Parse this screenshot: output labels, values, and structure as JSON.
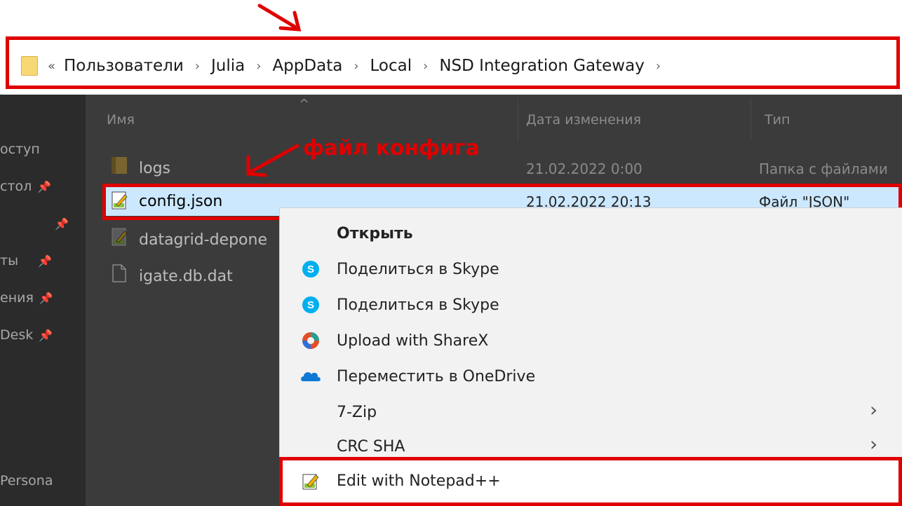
{
  "annotation": {
    "top_text": "",
    "config_label": "файл конфига"
  },
  "address_bar": {
    "overflow": "«",
    "crumbs": [
      "Пользователи",
      "Julia",
      "AppData",
      "Local",
      "NSD Integration Gateway"
    ],
    "separator": "›"
  },
  "columns": {
    "name": "Имя",
    "date": "Дата изменения",
    "type": "Тип"
  },
  "nav": {
    "items": [
      "оступ",
      "стол",
      "",
      "ты",
      "ения",
      "Desk",
      "Persona"
    ]
  },
  "files": [
    {
      "name": "logs",
      "date": "21.02.2022 0:00",
      "type": "Папка с файлами",
      "icon": "folder-icon"
    },
    {
      "name": "config.json",
      "date": "21.02.2022 20:13",
      "type": "Файл \"JSON\"",
      "icon": "notepad-file-icon",
      "selected": true
    },
    {
      "name": "datagrid-depone",
      "date": "",
      "type": "",
      "icon": "notepad-file-icon"
    },
    {
      "name": "igate.db.dat",
      "date": "",
      "type": "",
      "icon": "file-icon"
    }
  ],
  "context_menu": {
    "items": [
      {
        "label": "Открыть",
        "bold": true,
        "icon": ""
      },
      {
        "label": "Поделиться в Skype",
        "icon": "skype-icon"
      },
      {
        "label": "Поделиться в Skype",
        "icon": "skype-icon"
      },
      {
        "label": "Upload with ShareX",
        "icon": "sharex-icon"
      },
      {
        "label": "Переместить в OneDrive",
        "icon": "onedrive-icon"
      },
      {
        "label": "7-Zip",
        "submenu": true
      },
      {
        "label": "CRC SHA",
        "submenu": true
      },
      {
        "label": "Edit with Notepad++",
        "icon": "notepad-plus-plus-icon"
      }
    ]
  },
  "colors": {
    "annotation_red": "#e00000",
    "selection": "#cce8ff",
    "skype_blue": "#00aff0",
    "onedrive_blue": "#0f78d4"
  }
}
